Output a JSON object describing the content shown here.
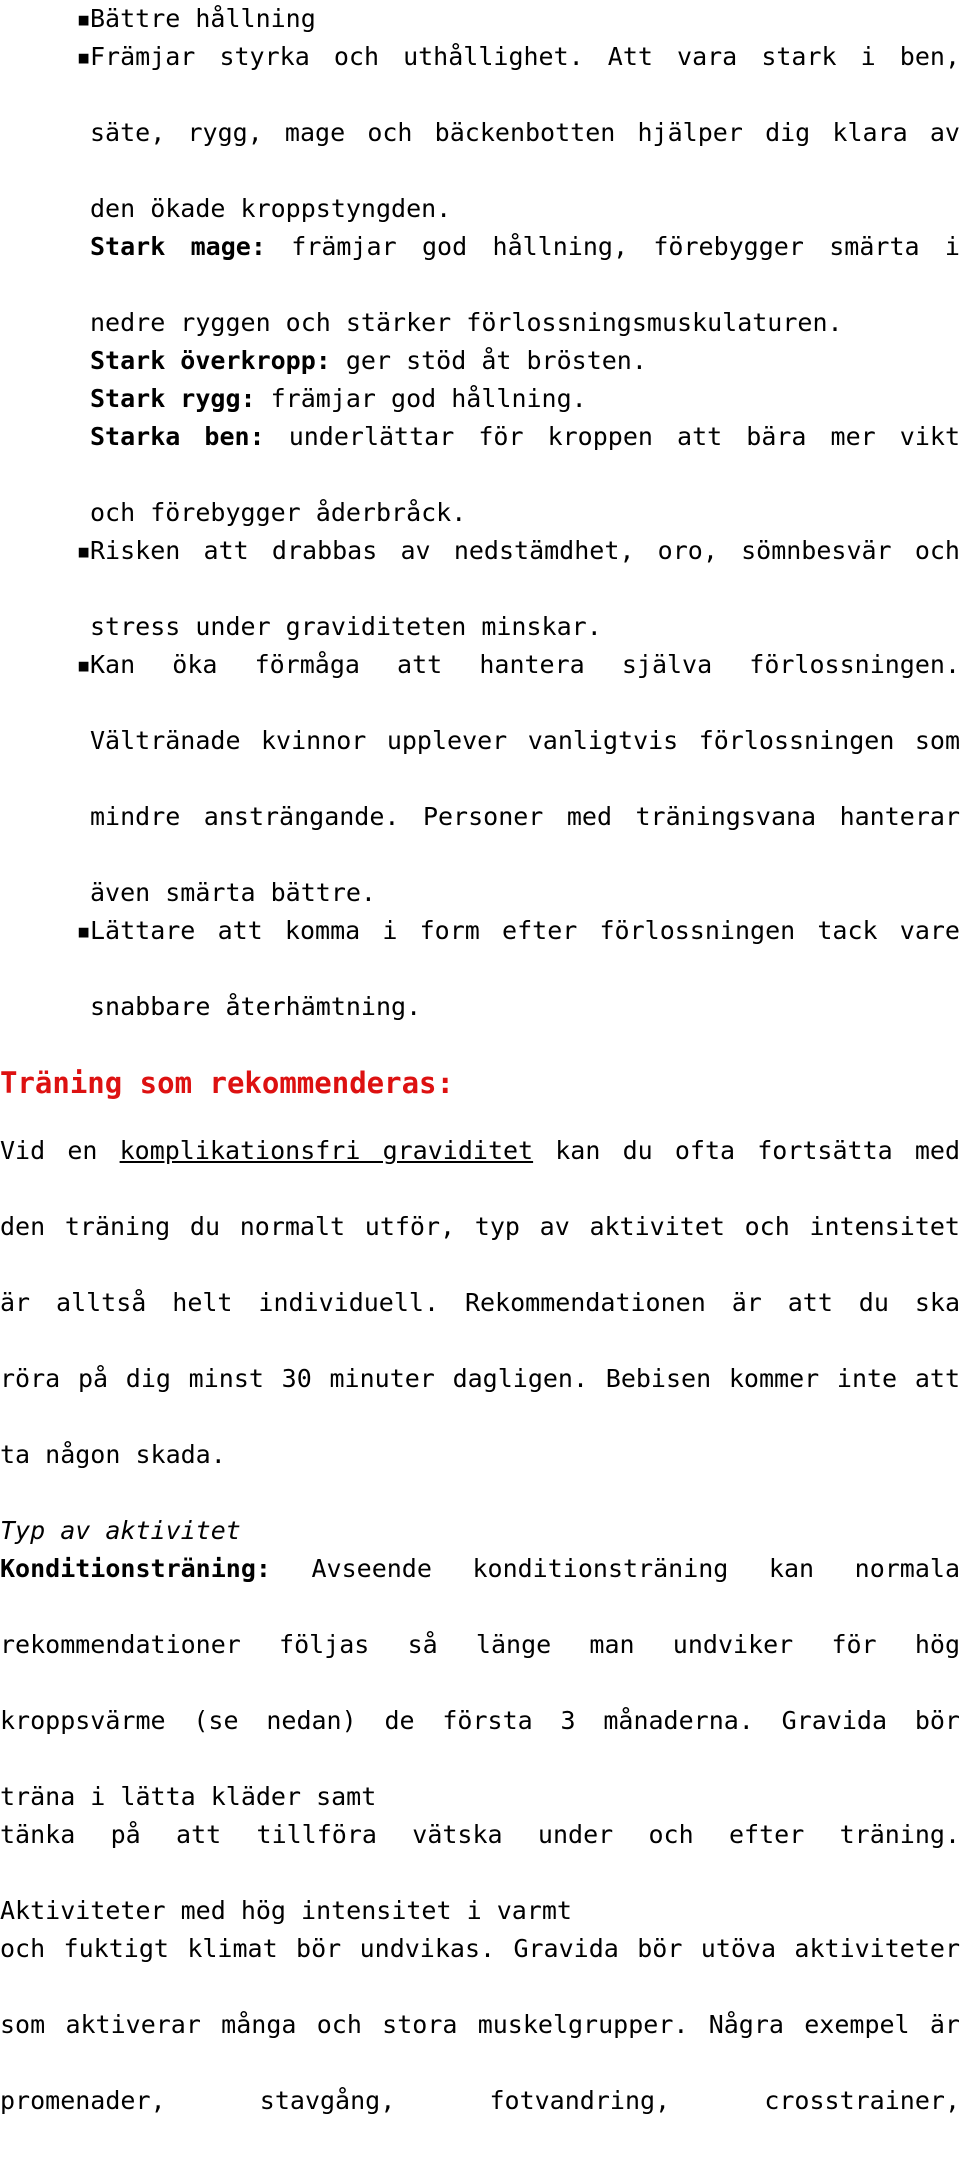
{
  "document": {
    "language": "sv",
    "colors": {
      "heading_red": "#dd1111",
      "body_black": "#000000",
      "page_background": "#ffffff"
    },
    "bullet_glyph": "▪"
  },
  "benefits_list": {
    "items": [
      {
        "lines": [
          {
            "type": "plain",
            "text": "Bättre hållning"
          }
        ]
      },
      {
        "lines": [
          {
            "type": "plain",
            "text": "Främjar styrka och uthållighet. Att vara stark i ben,"
          },
          {
            "type": "plain",
            "text": "säte, rygg, mage och bäckenbotten hjälper dig klara av"
          },
          {
            "type": "plain",
            "text": "den ökade kroppstyngden."
          },
          {
            "type": "labeled",
            "label": "Stark mage:",
            "text": " främjar god hållning, förebygger smärta i"
          },
          {
            "type": "plain",
            "text": "nedre ryggen och stärker förlossningsmuskulaturen."
          },
          {
            "type": "labeled",
            "label": "Stark överkropp:",
            "text": " ger stöd åt brösten."
          },
          {
            "type": "labeled",
            "label": "Stark rygg:",
            "text": " främjar god hållning."
          },
          {
            "type": "labeled",
            "label": "Starka ben:",
            "text": " underlättar för kroppen att bära mer vikt"
          },
          {
            "type": "plain",
            "text": "och förebygger åderbråck."
          }
        ]
      },
      {
        "lines": [
          {
            "type": "plain",
            "text": "Risken att drabbas av nedstämdhet, oro, sömnbesvär och"
          },
          {
            "type": "plain",
            "text": "stress under graviditeten minskar."
          }
        ]
      },
      {
        "lines": [
          {
            "type": "plain",
            "text": "Kan öka förmåga att hantera själva förlossningen."
          },
          {
            "type": "plain",
            "text": "Vältränade kvinnor upplever vanligtvis förlossningen som"
          },
          {
            "type": "plain",
            "text": "mindre ansträngande. Personer med träningsvana hanterar"
          },
          {
            "type": "plain",
            "text": "även smärta bättre."
          }
        ]
      },
      {
        "lines": [
          {
            "type": "plain",
            "text": "Lättare att komma i form efter förlossningen tack vare"
          },
          {
            "type": "plain",
            "text": "snabbare återhämtning."
          }
        ]
      }
    ]
  },
  "recommended_section": {
    "heading": "Träning som rekommenderas:",
    "paragraph_lines": [
      {
        "segments": [
          {
            "text": "Vid en ",
            "style": "plain"
          },
          {
            "text": "komplikationsfri graviditet",
            "style": "underline"
          },
          {
            "text": " kan du ofta fortsätta med",
            "style": "plain"
          }
        ]
      },
      {
        "segments": [
          {
            "text": "den träning du normalt utför, typ av aktivitet och intensitet",
            "style": "plain"
          }
        ]
      },
      {
        "segments": [
          {
            "text": "är alltså helt individuell. Rekommendationen är att du ska",
            "style": "plain"
          }
        ]
      },
      {
        "segments": [
          {
            "text": "röra på dig minst 30 minuter dagligen. Bebisen kommer inte att",
            "style": "plain"
          }
        ]
      },
      {
        "segments": [
          {
            "text": "ta någon skada.",
            "style": "plain"
          }
        ]
      }
    ]
  },
  "activity_type_section": {
    "subheading_italic": "Typ av aktivitet",
    "lines": [
      {
        "type": "labeled",
        "label": "Konditionsträning:",
        "text": " Avseende konditionsträning kan normala"
      },
      {
        "type": "plain",
        "text": "rekommendationer följas så länge man undviker för hög"
      },
      {
        "type": "plain",
        "text": "kroppsvärme (se nedan) de första 3 månaderna. Gravida bör"
      },
      {
        "type": "plain",
        "text": "träna i lätta kläder samt"
      },
      {
        "type": "plain",
        "text": "tänka på att tillföra vätska under och efter träning."
      },
      {
        "type": "plain",
        "text": "Aktiviteter med hög intensitet i varmt"
      },
      {
        "type": "plain",
        "text": "och fuktigt klimat bör undvikas. Gravida bör utöva aktiviteter"
      },
      {
        "type": "plain",
        "text": "som aktiverar många och stora muskelgrupper. Några exempel är"
      },
      {
        "type": "plain",
        "text": "promenader, stavgång, fotvandring, crosstrainer,"
      }
    ]
  }
}
